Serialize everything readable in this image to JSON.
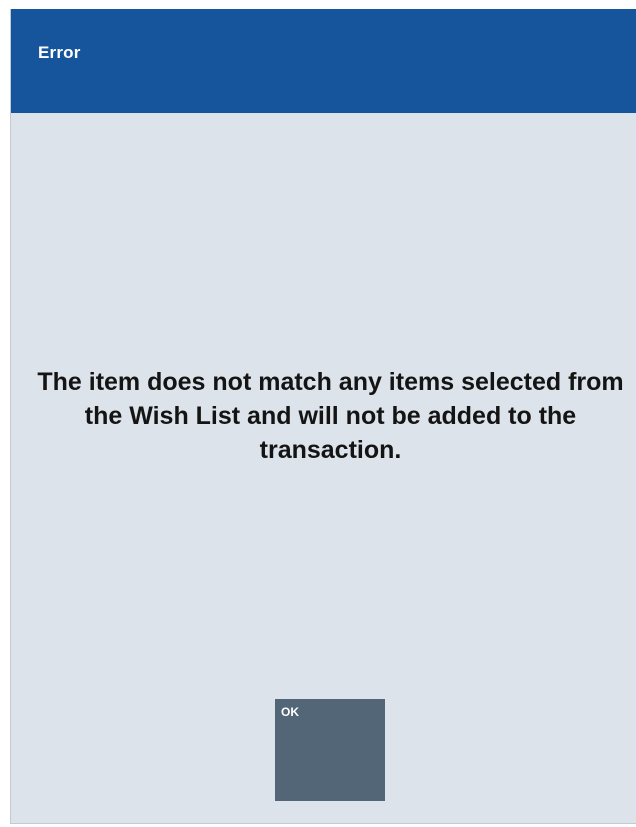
{
  "dialog": {
    "title": "Error",
    "message": "The item does not match any items selected from the Wish List and will not be added to the transaction.",
    "ok_label": "OK"
  },
  "colors": {
    "header_bg": "#16559c",
    "body_bg": "#dde3ea",
    "button_bg": "#536678",
    "message_text": "#141414"
  }
}
